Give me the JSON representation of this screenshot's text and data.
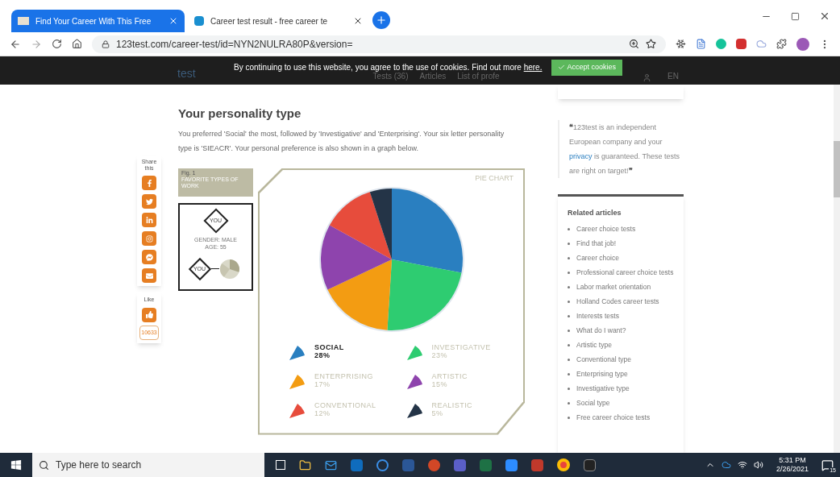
{
  "browser": {
    "tabs": [
      {
        "title": "Find Your Career With This Free",
        "selected": true
      },
      {
        "title": "Career test result - free career te",
        "selected": false
      }
    ],
    "url": "123test.com/career-test/id=NYN2NULRA80P&version="
  },
  "site_nav": {
    "logo": "test",
    "items": [
      "Tests (36)",
      "Articles",
      "List of profe"
    ],
    "language": "EN"
  },
  "cookie_banner": {
    "text": "By continuing to use this website, you agree to the use of cookies. Find out more ",
    "link": "here.",
    "button": "Accept cookies"
  },
  "share": {
    "label": "Share this",
    "like_label": "Like",
    "like_count": "10633"
  },
  "section": {
    "title": "Your personality type",
    "text": "You preferred 'Social' the most, followed by 'Investigative' and 'Enterprising'. Your six letter personality type is 'SIEACR'. Your personal preference is also shown in a graph below."
  },
  "figure": {
    "number": "Fig. 1",
    "caption": "FAVORITE TYPES OF WORK",
    "you": "YOU",
    "gender": "GENDER: MALE",
    "age": "AGE: 55",
    "you_small": "YOU"
  },
  "chart": {
    "label": "PIE CHART",
    "chart_data": {
      "type": "pie",
      "categories": [
        "SOCIAL",
        "INVESTIGATIVE",
        "ENTERPRISING",
        "ARTISTIC",
        "CONVENTIONAL",
        "REALISTIC"
      ],
      "series": [
        {
          "values": [
            28,
            23,
            17,
            15,
            12,
            5
          ]
        }
      ]
    },
    "legend": [
      {
        "value": "28%",
        "color": "#2a7fc0",
        "selected": true
      },
      {
        "value": "23%",
        "color": "#2ecc71",
        "selected": false
      },
      {
        "value": "17%",
        "color": "#f39c12",
        "selected": false
      },
      {
        "value": "15%",
        "color": "#8e44ad",
        "selected": false
      },
      {
        "value": "12%",
        "color": "#e74c3c",
        "selected": false
      },
      {
        "value": "5%",
        "color": "#243447",
        "selected": false
      }
    ]
  },
  "quote": {
    "open": "❝",
    "before": "123test is an independent European company and your ",
    "link": "privacy",
    "after": " is guaranteed. These tests are right on target!",
    "close": "❞"
  },
  "related": {
    "title": "Related articles",
    "items": [
      "Career choice tests",
      "Find that job!",
      "Career choice",
      "Professional career choice tests",
      "Labor market orientation",
      "Holland Codes career tests",
      "Interests tests",
      "What do I want?",
      "Artistic type",
      "Conventional type",
      "Enterprising type",
      "Investigative type",
      "Social type",
      "Free career choice tests"
    ]
  },
  "taskbar": {
    "search_placeholder": "Type here to search",
    "time": "5:31 PM",
    "date": "2/26/2021",
    "notifications": "15"
  }
}
